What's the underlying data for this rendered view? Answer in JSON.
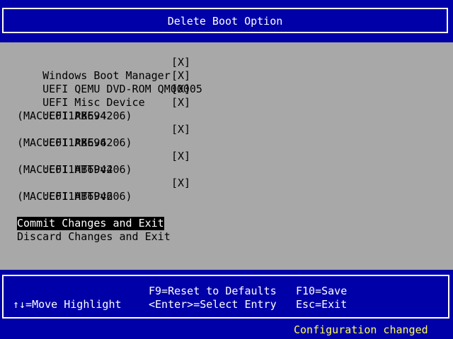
{
  "header": {
    "title": "Delete Boot Option"
  },
  "boot_options": [
    {
      "name": "Windows Boot Manager",
      "check": "[X]"
    },
    {
      "name": "UEFI QEMU DVD-ROM QM00005",
      "check": "[X]"
    },
    {
      "name": "UEFI Misc Device",
      "check": "[X]"
    },
    {
      "name": "UEFI PXEv4",
      "check": "[X]",
      "detail": "(MAC:C011AB694206)"
    },
    {
      "name": "UEFI PXEv6",
      "check": "[X]",
      "detail": "(MAC:C011AB694206)"
    },
    {
      "name": "UEFI HTTPv4",
      "check": "[X]",
      "detail": "(MAC:C011AB694206)"
    },
    {
      "name": "UEFI HTTPv6",
      "check": "[X]",
      "detail": "(MAC:C011AB694206)"
    }
  ],
  "actions": {
    "commit": "Commit Changes and Exit",
    "discard": "Discard Changes and Exit"
  },
  "footer": {
    "move_highlight": "↑↓=Move Highlight",
    "reset_defaults": "F9=Reset to Defaults",
    "select_entry": "<Enter>=Select Entry",
    "save": "F10=Save",
    "exit": "Esc=Exit"
  },
  "status": "Configuration changed",
  "colors": {
    "background": "#0000a8",
    "panel": "#a8a8a8",
    "highlight_bg": "#000000",
    "status_text": "#ffff54"
  }
}
